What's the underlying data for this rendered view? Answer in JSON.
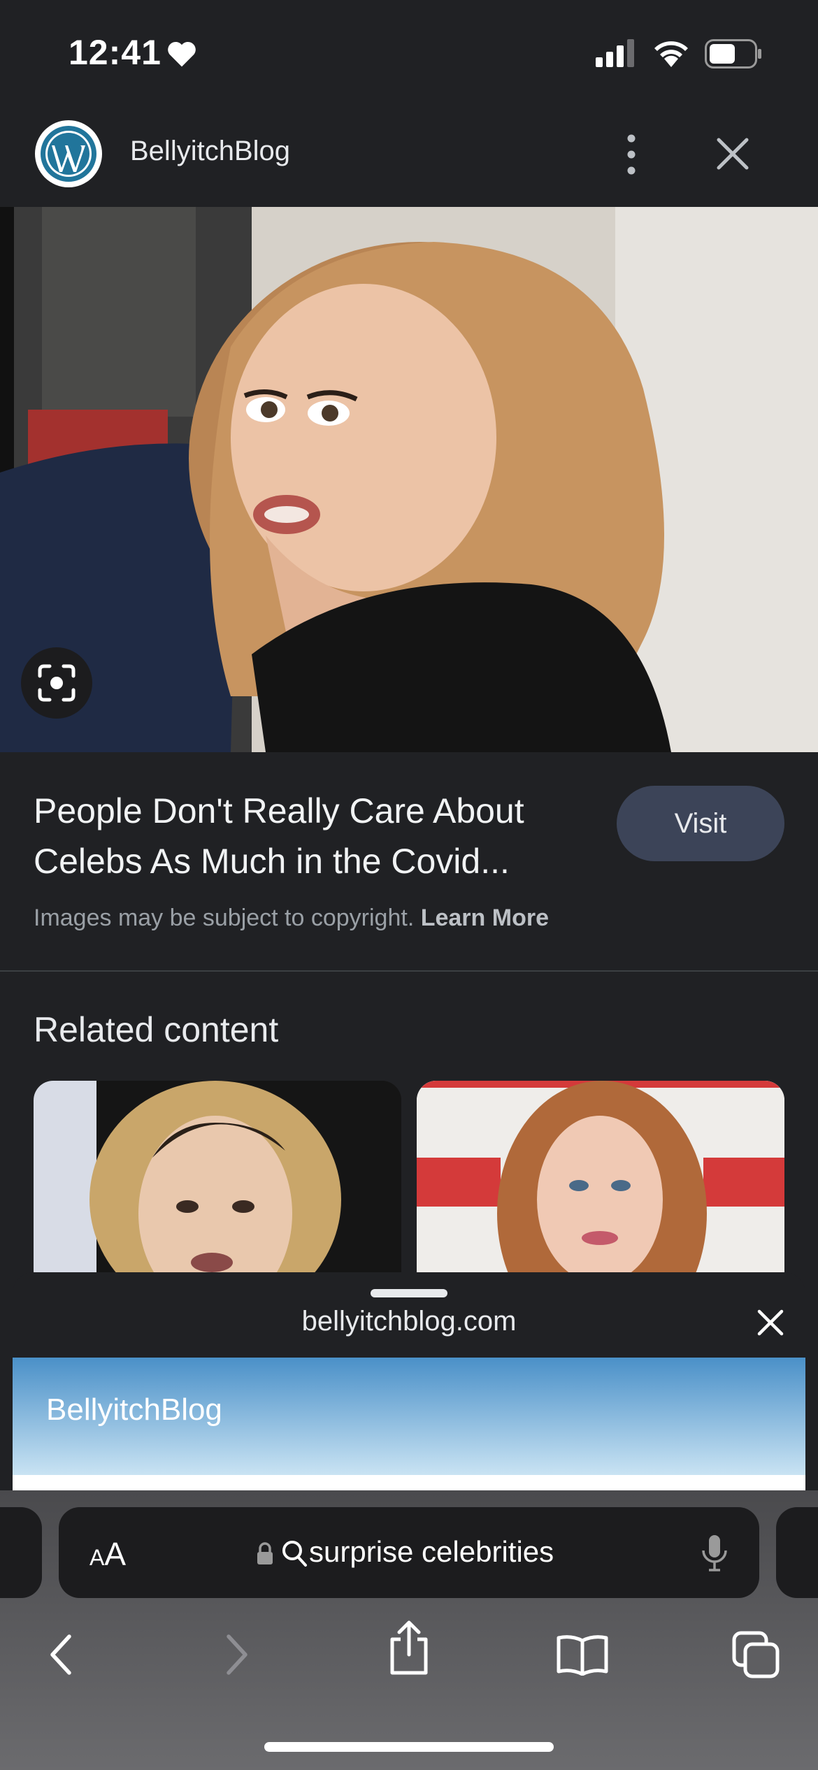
{
  "status": {
    "time": "12:41"
  },
  "header": {
    "site_name": "BellyitchBlog"
  },
  "result": {
    "title": "People Don't Really Care About Celebs As Much in the Covid...",
    "visit_label": "Visit",
    "copyright_text": "Images may be subject to copyright.",
    "learn_more": "Learn More"
  },
  "related": {
    "title": "Related content"
  },
  "sheet": {
    "domain": "bellyitchblog.com",
    "banner_title": "BellyitchBlog"
  },
  "addressbar": {
    "aa_label_small": "A",
    "aa_label_large": "A",
    "query": "surprise celebrities"
  },
  "colors": {
    "background": "#202124",
    "visit_button": "#3c4458",
    "banner_top": "#4a90c8",
    "banner_bottom": "#c9e3f3"
  },
  "icons": [
    "heart-icon",
    "signal-icon",
    "wifi-icon",
    "battery-icon",
    "wordpress-icon",
    "more-vert-icon",
    "close-icon",
    "lens-icon",
    "lock-icon",
    "search-icon",
    "mic-icon",
    "back-icon",
    "forward-icon",
    "share-icon",
    "bookmarks-icon",
    "tabs-icon"
  ]
}
